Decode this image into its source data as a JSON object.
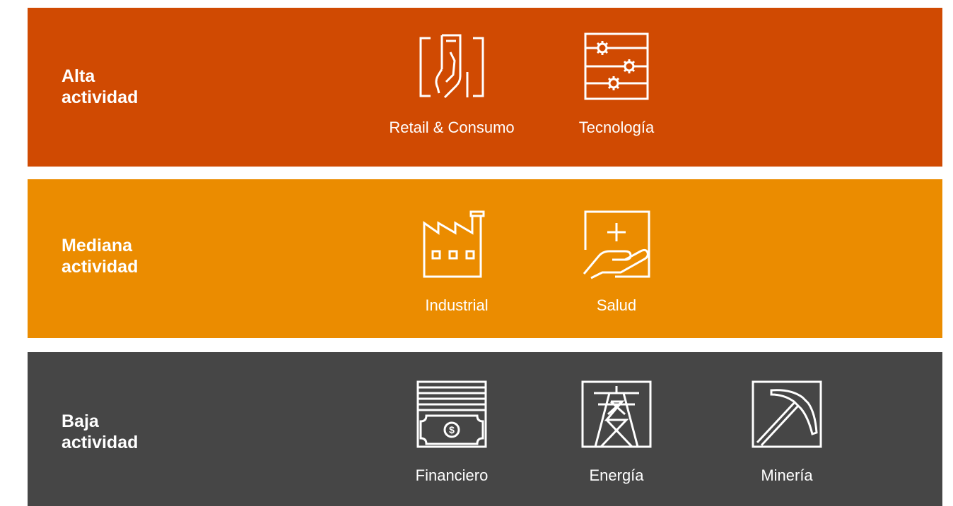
{
  "bands": [
    {
      "title": "Alta\nactividad",
      "color": "#D04A02",
      "sectors": [
        {
          "label": "Retail & Consumo",
          "icon": "card-hand-icon"
        },
        {
          "label": "Tecnología",
          "icon": "gears-panel-icon"
        }
      ]
    },
    {
      "title": "Mediana\nactividad",
      "color": "#EB8C00",
      "sectors": [
        {
          "label": "Industrial",
          "icon": "factory-icon"
        },
        {
          "label": "Salud",
          "icon": "hand-plus-icon"
        }
      ]
    },
    {
      "title": "Baja\nactividad",
      "color": "#464646",
      "sectors": [
        {
          "label": "Financiero",
          "icon": "banknote-icon"
        },
        {
          "label": "Energía",
          "icon": "power-tower-icon"
        },
        {
          "label": "Minería",
          "icon": "pickaxe-icon"
        }
      ]
    }
  ]
}
